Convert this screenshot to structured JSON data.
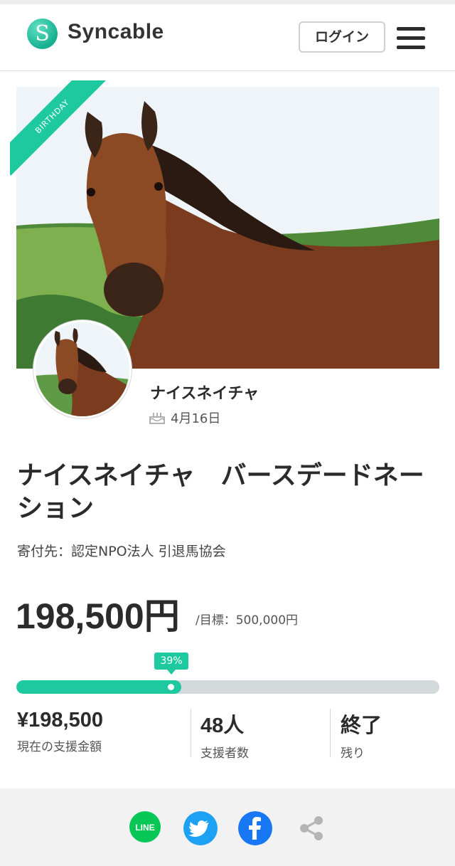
{
  "header": {
    "logo_letter": "S",
    "logo_text": "Syncable",
    "login_label": "ログイン",
    "menu_icon": "hamburger-menu-icon"
  },
  "hero": {
    "ribbon_text": "BIRTHDAY"
  },
  "profile": {
    "name": "ナイスネイチャ",
    "birthday": "4月16日"
  },
  "campaign": {
    "title": "ナイスネイチャ　バースデードネーション",
    "beneficiary": "寄付先：認定NPO法人 引退馬協会",
    "amount": "198,500円",
    "goal": "/目標：500,000円",
    "progress_label": "39%",
    "progress_fraction": 0.39
  },
  "stats": [
    {
      "value": "¥198,500",
      "label": "現在の支援金額"
    },
    {
      "value": "48人",
      "label": "支援者数"
    },
    {
      "value": "終了",
      "label": "残り"
    }
  ],
  "share": {
    "line_label": "LINE",
    "icons": [
      "line-icon",
      "twitter-icon",
      "facebook-icon",
      "share-icon"
    ]
  },
  "colors": {
    "accent": "#1ec9a0",
    "twitter": "#1da1f2",
    "facebook": "#1877f2",
    "line": "#06c755"
  }
}
